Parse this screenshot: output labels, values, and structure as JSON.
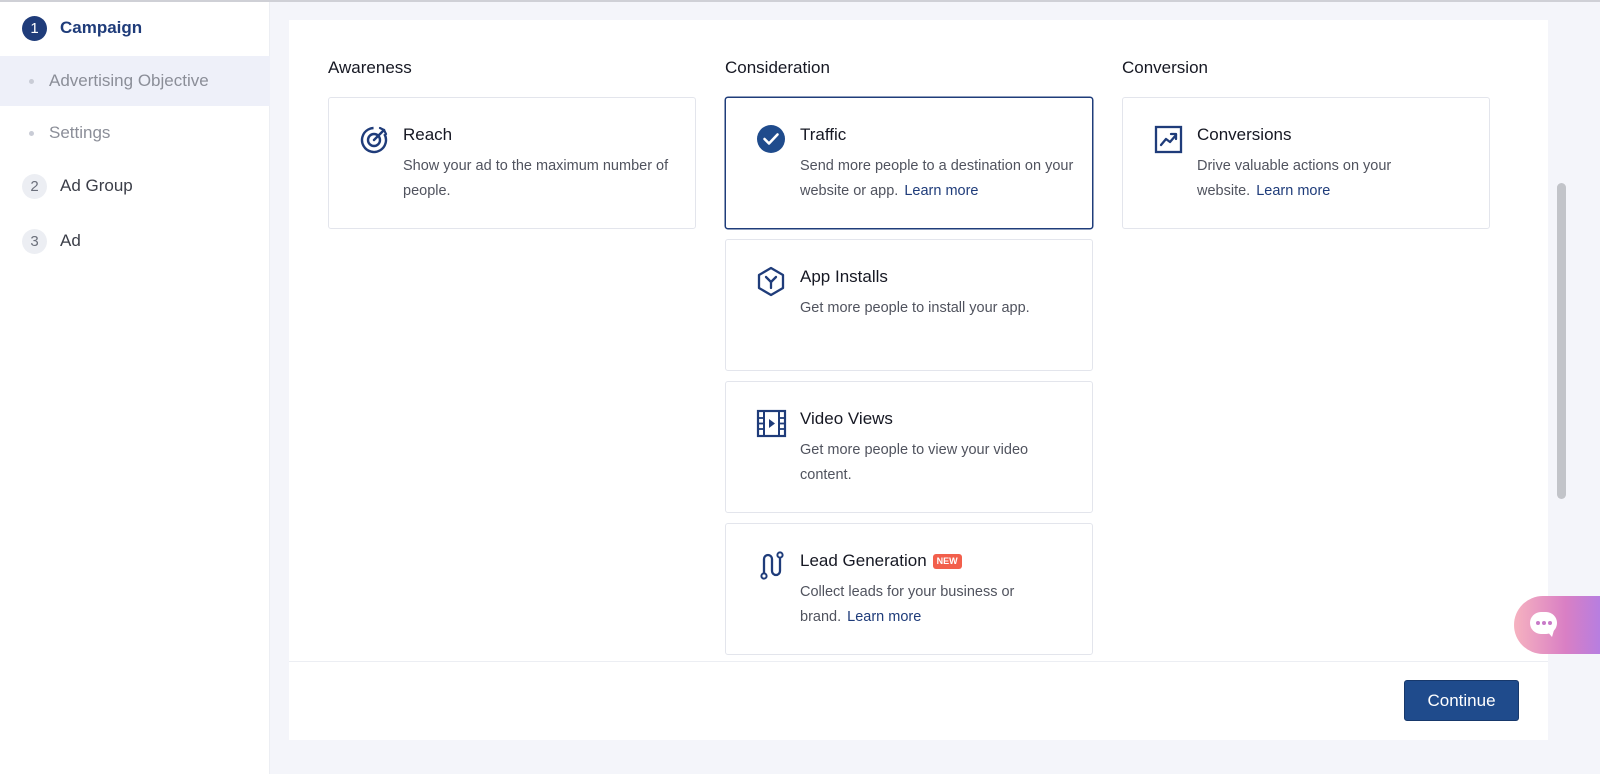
{
  "sidebar": {
    "steps": [
      {
        "number": "1",
        "label": "Campaign",
        "active": true
      },
      {
        "number": "2",
        "label": "Ad Group",
        "active": false
      },
      {
        "number": "3",
        "label": "Ad",
        "active": false
      }
    ],
    "substeps": [
      {
        "label": "Advertising Objective",
        "selected": true
      },
      {
        "label": "Settings",
        "selected": false
      }
    ]
  },
  "columns": {
    "awareness": {
      "heading": "Awareness",
      "cards": [
        {
          "icon": "reach-target-icon",
          "title": "Reach",
          "desc": "Show your ad to the maximum number of people.",
          "learn_more": "",
          "badge": "",
          "selected": false
        }
      ]
    },
    "consideration": {
      "heading": "Consideration",
      "cards": [
        {
          "icon": "check-circle-icon",
          "title": "Traffic",
          "desc": "Send more people to a destination on your website or app.",
          "learn_more": "Learn more",
          "badge": "",
          "selected": true
        },
        {
          "icon": "app-hexagon-icon",
          "title": "App Installs",
          "desc": "Get more people to install your app.",
          "learn_more": "",
          "badge": "",
          "selected": false
        },
        {
          "icon": "video-film-icon",
          "title": "Video Views",
          "desc": "Get more people to view your video content.",
          "learn_more": "",
          "badge": "",
          "selected": false
        },
        {
          "icon": "lead-path-icon",
          "title": "Lead Generation",
          "desc": "Collect leads for your business or brand.",
          "learn_more": "Learn more",
          "badge": "NEW",
          "selected": false
        }
      ]
    },
    "conversion": {
      "heading": "Conversion",
      "cards": [
        {
          "icon": "trend-chart-icon",
          "title": "Conversions",
          "desc": "Drive valuable actions on your website.",
          "learn_more": "Learn more",
          "badge": "",
          "selected": false
        }
      ]
    }
  },
  "footer": {
    "continue_label": "Continue"
  },
  "colors": {
    "accent": "#1f3c7a",
    "button": "#1f4b8c",
    "badge": "#f25f4c"
  }
}
